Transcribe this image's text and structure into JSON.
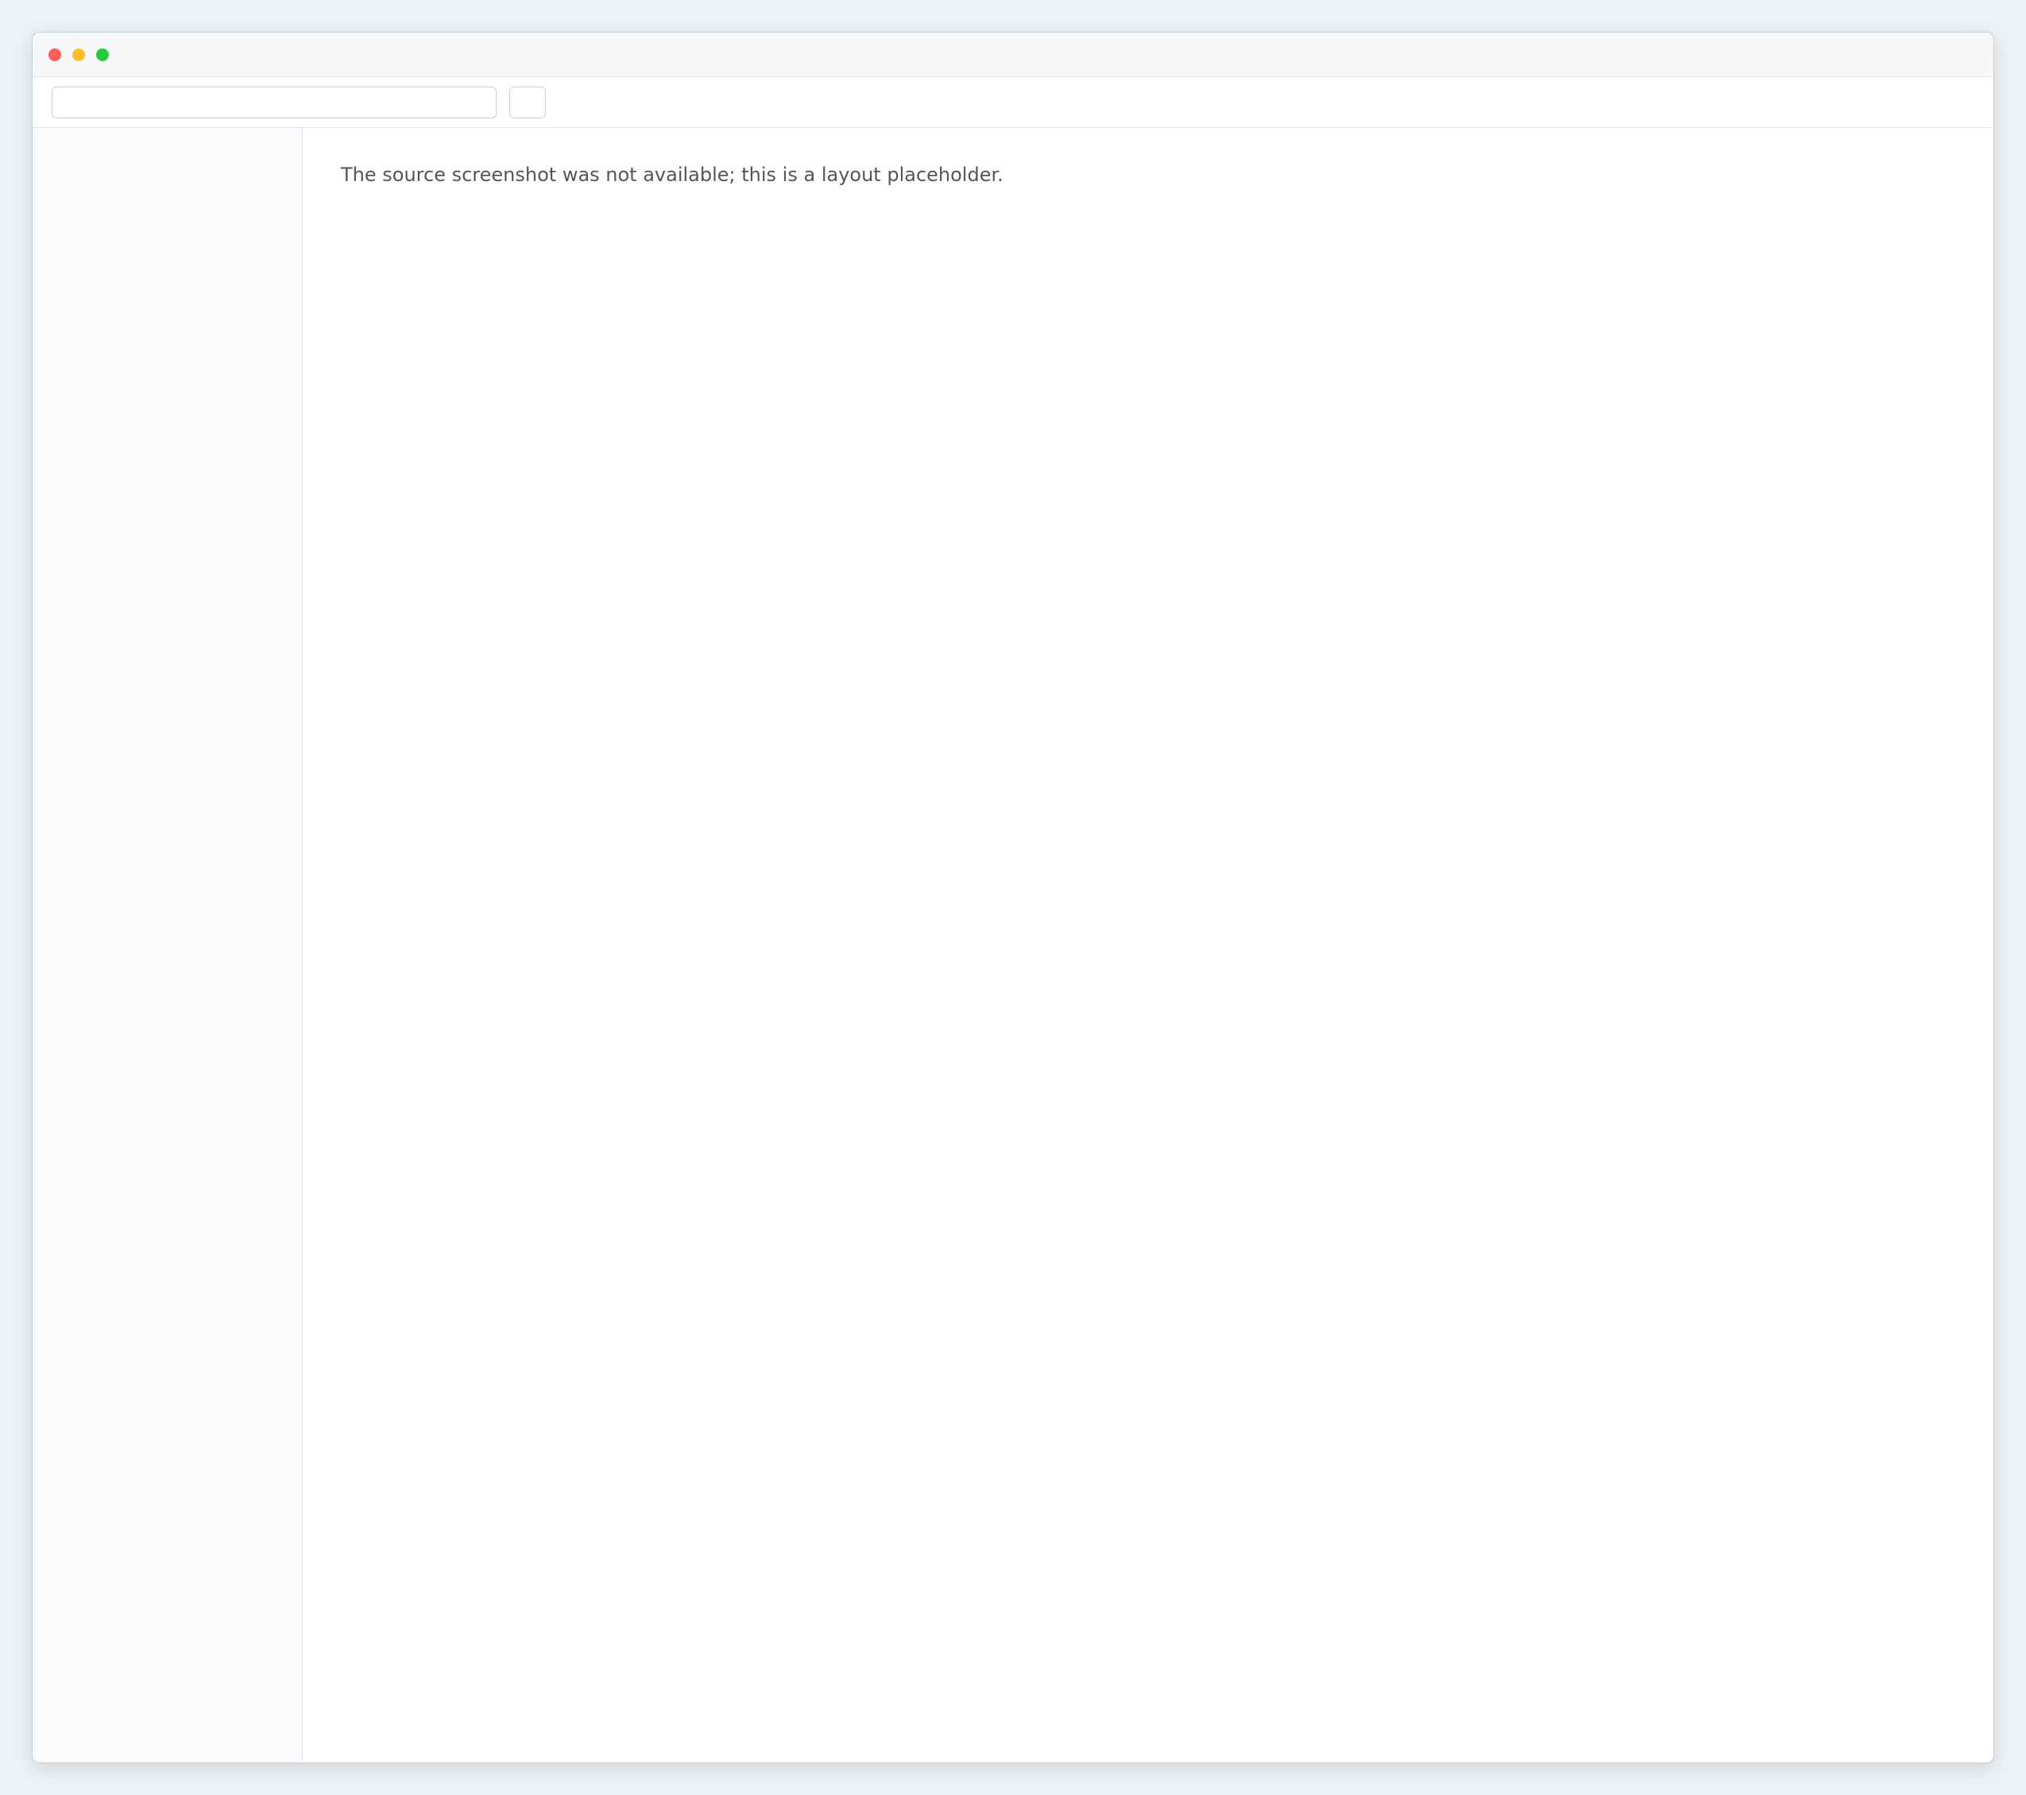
{
  "window": {
    "title": ""
  },
  "toolbar": {
    "search_placeholder": "",
    "primary_label": ""
  },
  "sidebar": {
    "items": [
      "",
      "",
      "",
      ""
    ]
  },
  "main": {
    "notice": "The source screenshot was not available; this is a layout placeholder."
  }
}
